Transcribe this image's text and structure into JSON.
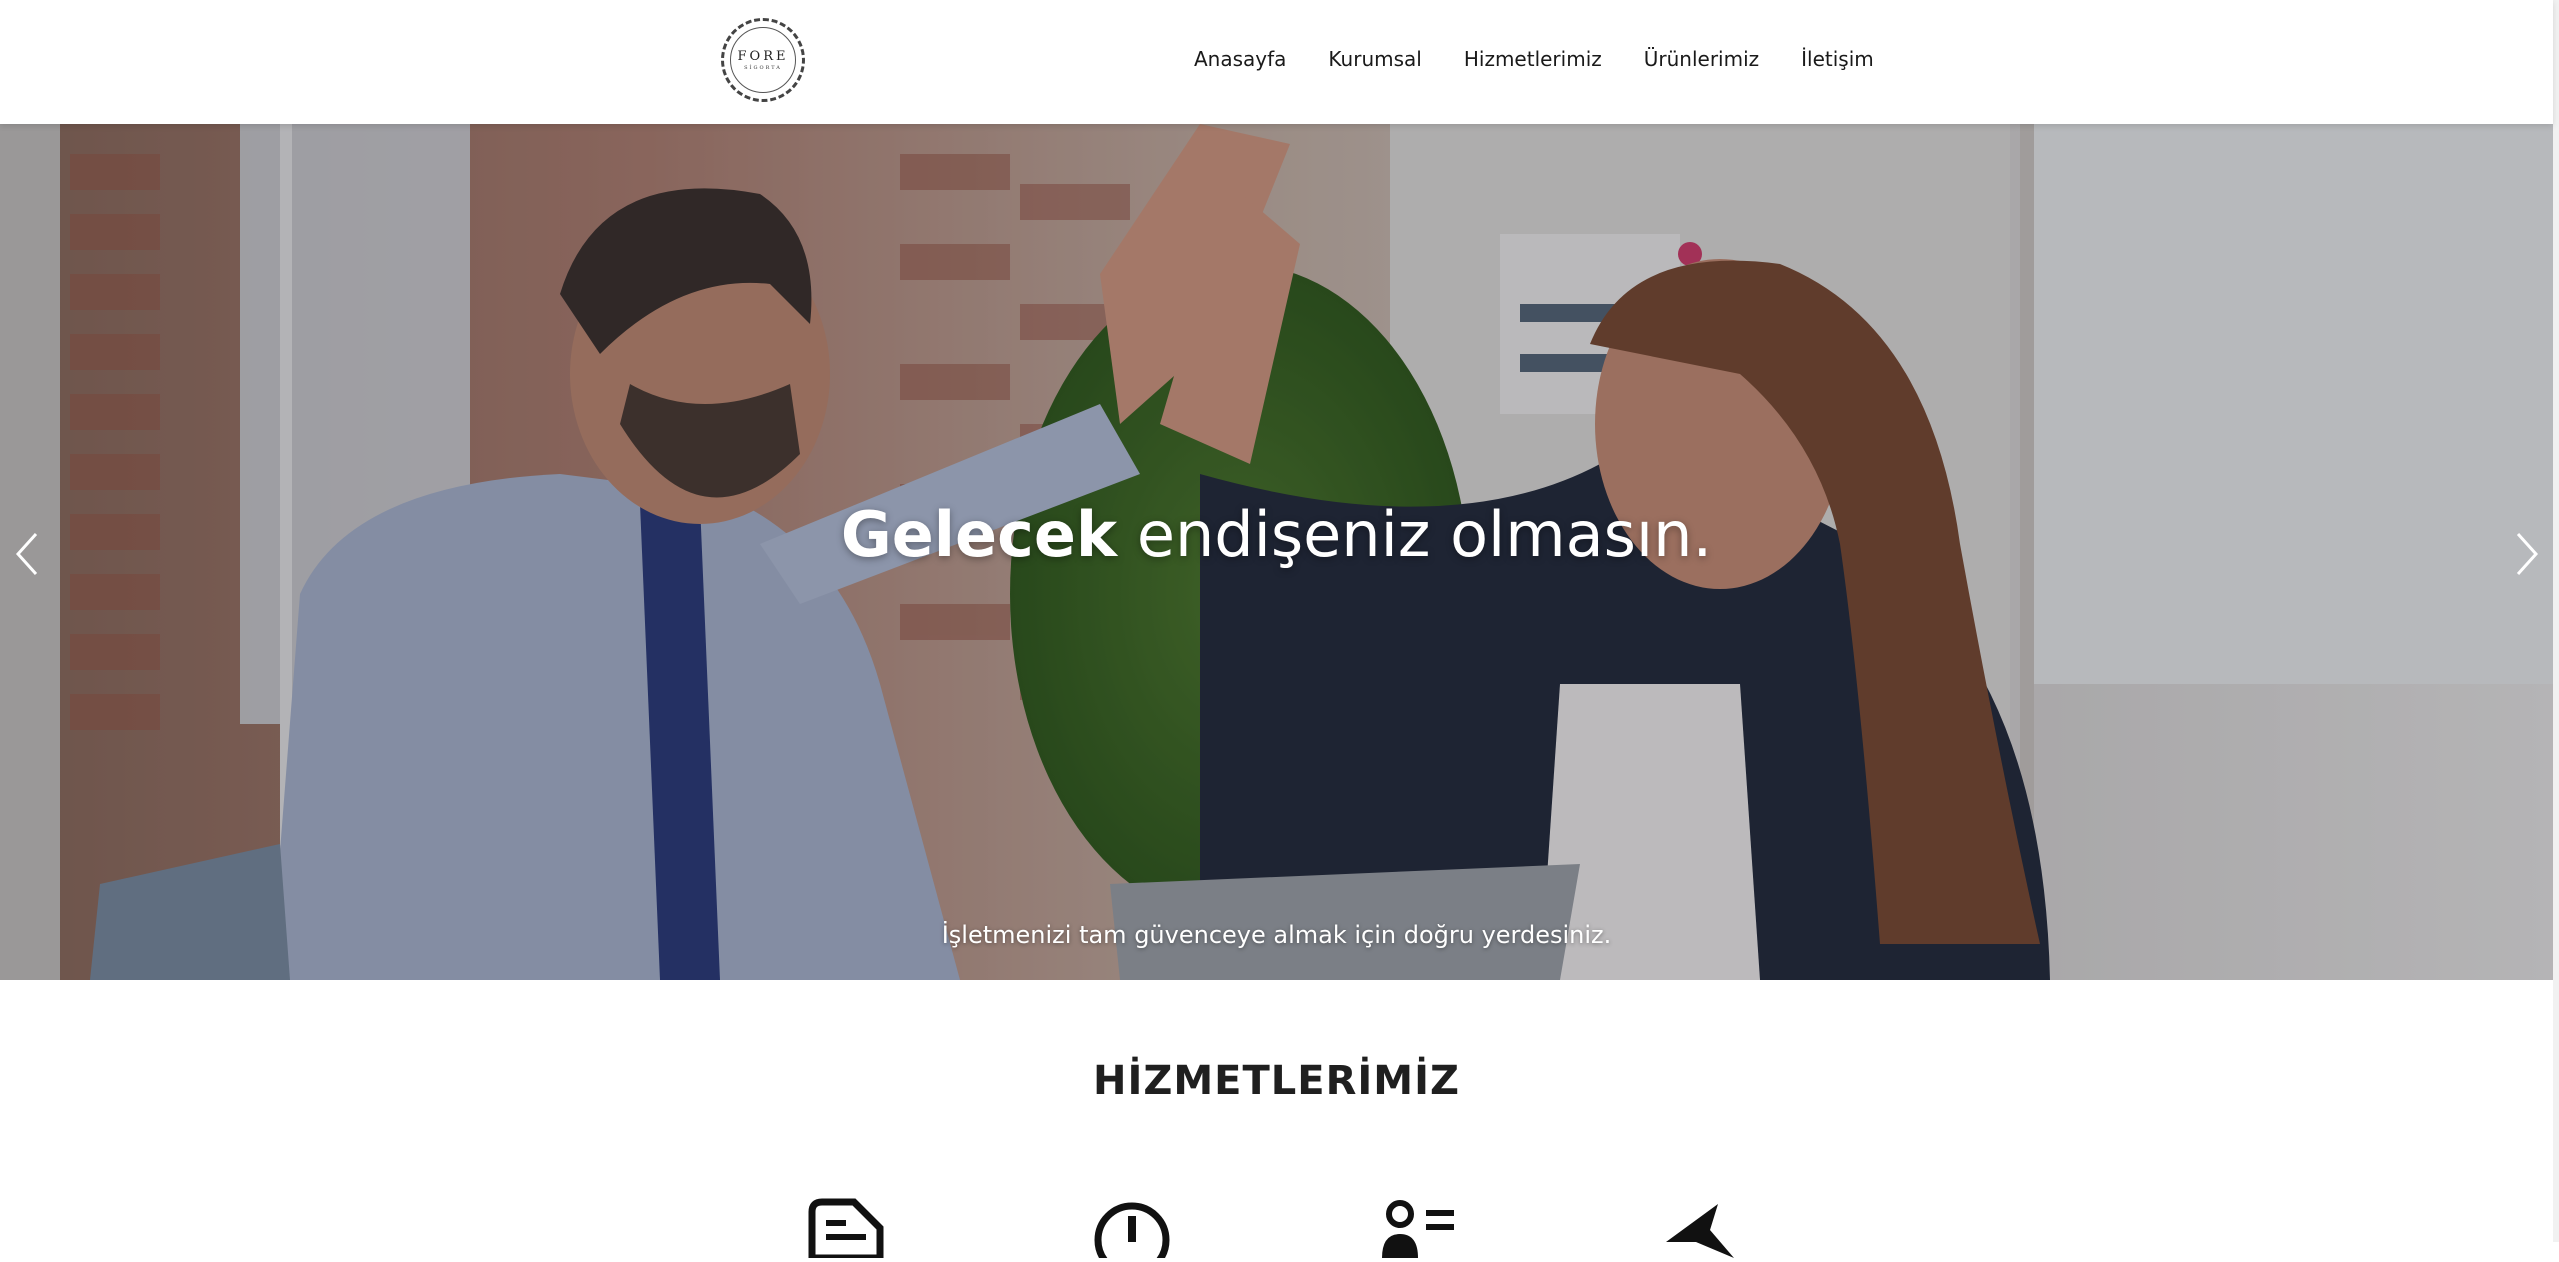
{
  "brand": {
    "logo_main": "FORE",
    "logo_sub": "SİGORTA"
  },
  "nav": {
    "items": [
      {
        "label": "Anasayfa"
      },
      {
        "label": "Kurumsal"
      },
      {
        "label": "Hizmetlerimiz"
      },
      {
        "label": "Ürünlerimiz"
      },
      {
        "label": "İletişim"
      }
    ]
  },
  "hero": {
    "title_bold": "Gelecek",
    "title_rest": " endişeniz olmasın.",
    "subtitle": "İşletmenizi tam güvenceye almak için doğru yerdesiniz.",
    "image_icon": "office-high-five-photo",
    "prev_icon": "chevron-left-icon",
    "next_icon": "chevron-right-icon"
  },
  "services": {
    "title": "HİZMETLERİMİZ",
    "icons": [
      "document-icon",
      "clock-icon",
      "user-list-icon",
      "send-icon"
    ]
  },
  "colors": {
    "nav_text": "#1a1a1a",
    "hero_text": "#ffffff",
    "heading": "#1f1f1f"
  }
}
